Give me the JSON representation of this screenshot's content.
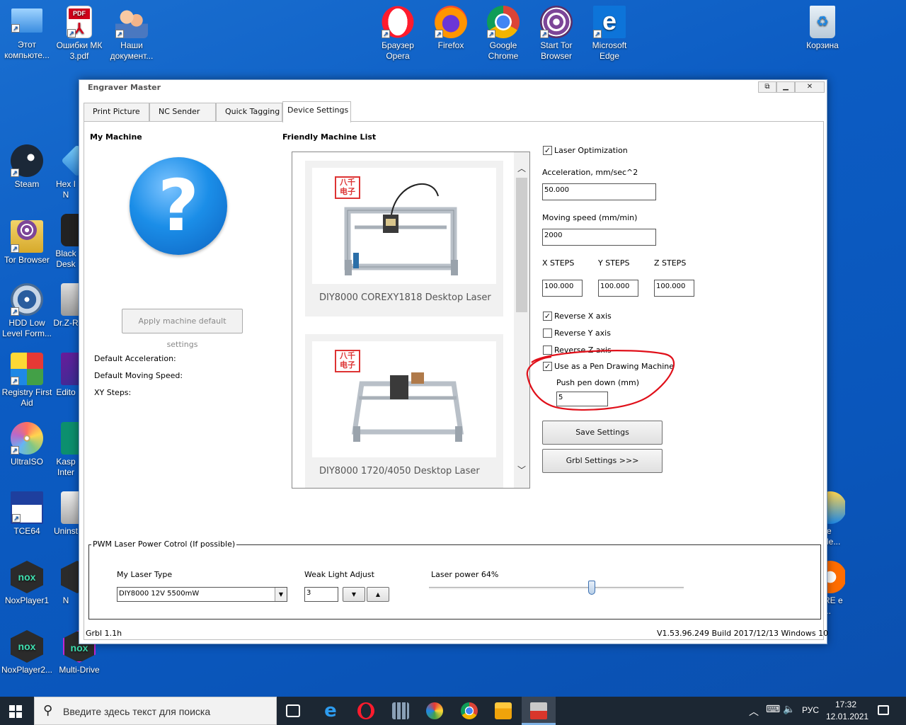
{
  "desktop": {
    "icons": [
      {
        "name": "this-pc",
        "label": "Этот компьюте..."
      },
      {
        "name": "pdf-file",
        "label": "Ошибки МК 3.pdf"
      },
      {
        "name": "documents",
        "label": "Наши документ..."
      },
      {
        "name": "opera",
        "label": "Браузер Opera"
      },
      {
        "name": "firefox",
        "label": "Firefox"
      },
      {
        "name": "chrome",
        "label": "Google Chrome"
      },
      {
        "name": "tor",
        "label": "Start Tor Browser"
      },
      {
        "name": "edge",
        "label": "Microsoft Edge"
      },
      {
        "name": "recycle-bin",
        "label": "Корзина"
      },
      {
        "name": "steam",
        "label": "Steam"
      },
      {
        "name": "hex",
        "label": "Hex I N"
      },
      {
        "name": "tor-browser",
        "label": "Tor Browser"
      },
      {
        "name": "blackberry",
        "label": "Black Desk"
      },
      {
        "name": "hdd-low-level",
        "label": "HDD Low Level Form..."
      },
      {
        "name": "drz",
        "label": "Dr.Z-R"
      },
      {
        "name": "registry-first-aid",
        "label": "Registry First Aid"
      },
      {
        "name": "editor",
        "label": "Edito"
      },
      {
        "name": "ultraiso",
        "label": "UltraISO"
      },
      {
        "name": "kaspersky",
        "label": "Kasp Inter"
      },
      {
        "name": "tce64",
        "label": "TCE64"
      },
      {
        "name": "uninstall",
        "label": "Uninst"
      },
      {
        "name": "noxplayer1",
        "label": "NoxPlayer1"
      },
      {
        "name": "nox2",
        "label": "N"
      },
      {
        "name": "noxplayer2",
        "label": "NoxPlayer2..."
      },
      {
        "name": "multi-drive",
        "label": "Multi-Drive"
      },
      {
        "name": "right-app-1",
        "label": "re de..."
      },
      {
        "name": "right-app-2",
        "label": "RE e ..."
      }
    ]
  },
  "window": {
    "title": "Engraver Master",
    "buttons": {
      "restore": "⧉",
      "minimize": "▁",
      "close": "✕"
    }
  },
  "tabs": [
    "Print Picture",
    "NC Sender",
    "Quick Tagging",
    "Device Settings"
  ],
  "my_machine": {
    "heading": "My Machine",
    "apply_button": "Apply machine default settings",
    "default_acceleration": "Default Acceleration:",
    "default_moving_speed": "Default Moving Speed:",
    "xy_steps": "XY Steps:"
  },
  "machine_list": {
    "heading": "Friendly Machine List",
    "items": [
      {
        "name": "DIY8000 COREXY1818 Desktop Laser",
        "seal": "八千\n电子"
      },
      {
        "name": "DIY8000 1720/4050 Desktop Laser",
        "seal": "八千\n电子"
      }
    ]
  },
  "settings": {
    "laser_optimization": {
      "label": "Laser Optimization",
      "checked": true
    },
    "acceleration_label": "Acceleration, mm/sec^2",
    "acceleration_value": "50.000",
    "moving_speed_label": "Moving speed  (mm/min)",
    "moving_speed_value": "2000",
    "x_steps_label": "X STEPS",
    "y_steps_label": "Y STEPS",
    "z_steps_label": "Z STEPS",
    "x_steps_value": "100.000",
    "y_steps_value": "100.000",
    "z_steps_value": "100.000",
    "reverse_x": {
      "label": "Reverse X axis",
      "checked": true
    },
    "reverse_y": {
      "label": "Reverse Y axis",
      "checked": false
    },
    "reverse_z": {
      "label": "Reverse Z axis",
      "checked": false
    },
    "pen_machine": {
      "label": "Use as a Pen Drawing Machine",
      "checked": true
    },
    "push_pen_label": "Push pen down (mm)",
    "push_pen_value": "5",
    "save_button": "Save Settings",
    "grbl_button": "Grbl Settings >>>",
    "highlight_color": "#e0101a"
  },
  "pwm": {
    "legend": "PWM Laser Power Cotrol (If possible)",
    "laser_type_label": "My Laser Type",
    "laser_type_value": "DIY8000 12V 5500mW",
    "weak_light_label": "Weak Light Adjust",
    "weak_light_value": "3",
    "laser_power_label": "Laser power 64%",
    "laser_power_fraction": 0.64
  },
  "status": {
    "grbl": "Grbl 1.1h",
    "version": "V1.53.96.249 Build 2017/12/13 Windows 10"
  },
  "taskbar": {
    "search_placeholder": "Введите здесь текст для поиска",
    "lang": "РУС",
    "time": "17:32",
    "date": "12.01.2021"
  }
}
